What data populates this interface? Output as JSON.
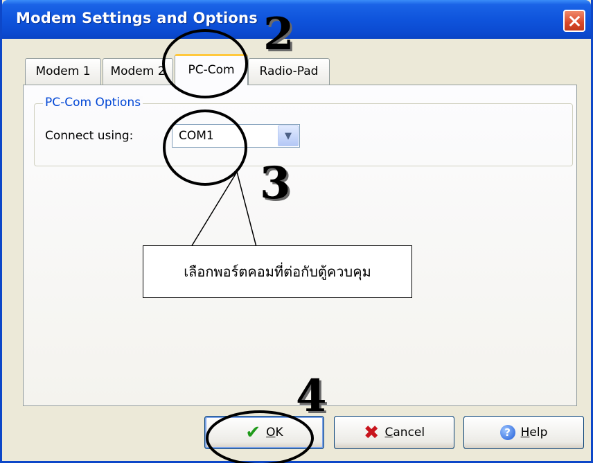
{
  "window": {
    "title": "Modem Settings and Options"
  },
  "tabs": [
    {
      "label": "Modem 1",
      "active": false
    },
    {
      "label": "Modem 2",
      "active": false
    },
    {
      "label": "PC-Com",
      "active": true
    },
    {
      "label": "Radio-Pad",
      "active": false
    }
  ],
  "group": {
    "legend": "PC-Com Options",
    "connect_label": "Connect using:",
    "connect_value": "COM1"
  },
  "buttons": {
    "ok": {
      "accel": "O",
      "rest": "K"
    },
    "cancel": {
      "accel": "C",
      "rest": "ancel"
    },
    "help": {
      "accel": "H",
      "rest": "elp"
    }
  },
  "annotations": {
    "step_tab": "2",
    "step_combo": "3",
    "step_ok": "4",
    "callout": "เลือกพอร์ตคอมที่ต่อกับตู้ควบคุม"
  },
  "colors": {
    "titlebar": "#0b4ad0",
    "tab_highlight": "#ffc83c",
    "group_legend": "#0046d5",
    "close_button": "#d9482a"
  },
  "icons": {
    "ok": "checkmark-icon",
    "cancel": "x-icon",
    "help": "question-icon",
    "combo": "chevron-down-icon"
  }
}
